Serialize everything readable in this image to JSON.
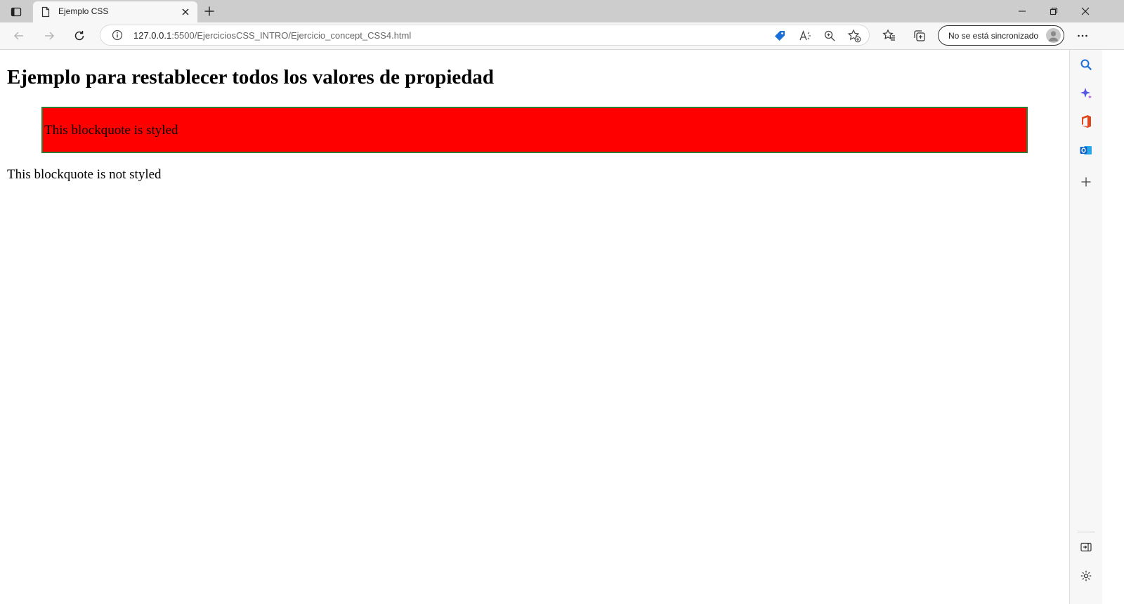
{
  "browser": {
    "tab_title": "Ejemplo CSS",
    "url_host": "127.0.0.1",
    "url_rest": ":5500/EjerciciosCSS_INTRO/Ejercicio_concept_CSS4.html",
    "sync_label": "No se está sincronizado"
  },
  "page": {
    "heading": "Ejemplo para restablecer todos los valores de propiedad",
    "styled_text": "This blockquote is styled",
    "plain_text": "This blockquote is not styled"
  },
  "colors": {
    "styled_bg": "#ff0000",
    "styled_border": "#2e7d32"
  },
  "icons": {
    "toolbar": [
      "back-icon",
      "forward-icon",
      "refresh-icon",
      "site-info-icon",
      "shopping-tag-icon",
      "read-aloud-icon",
      "zoom-icon",
      "add-favorite-icon",
      "favorites-icon",
      "collections-icon",
      "more-icon"
    ],
    "sidebar": [
      "search-icon",
      "copilot-icon",
      "office-icon",
      "outlook-icon",
      "add-icon",
      "hide-sidebar-icon",
      "settings-icon"
    ]
  }
}
